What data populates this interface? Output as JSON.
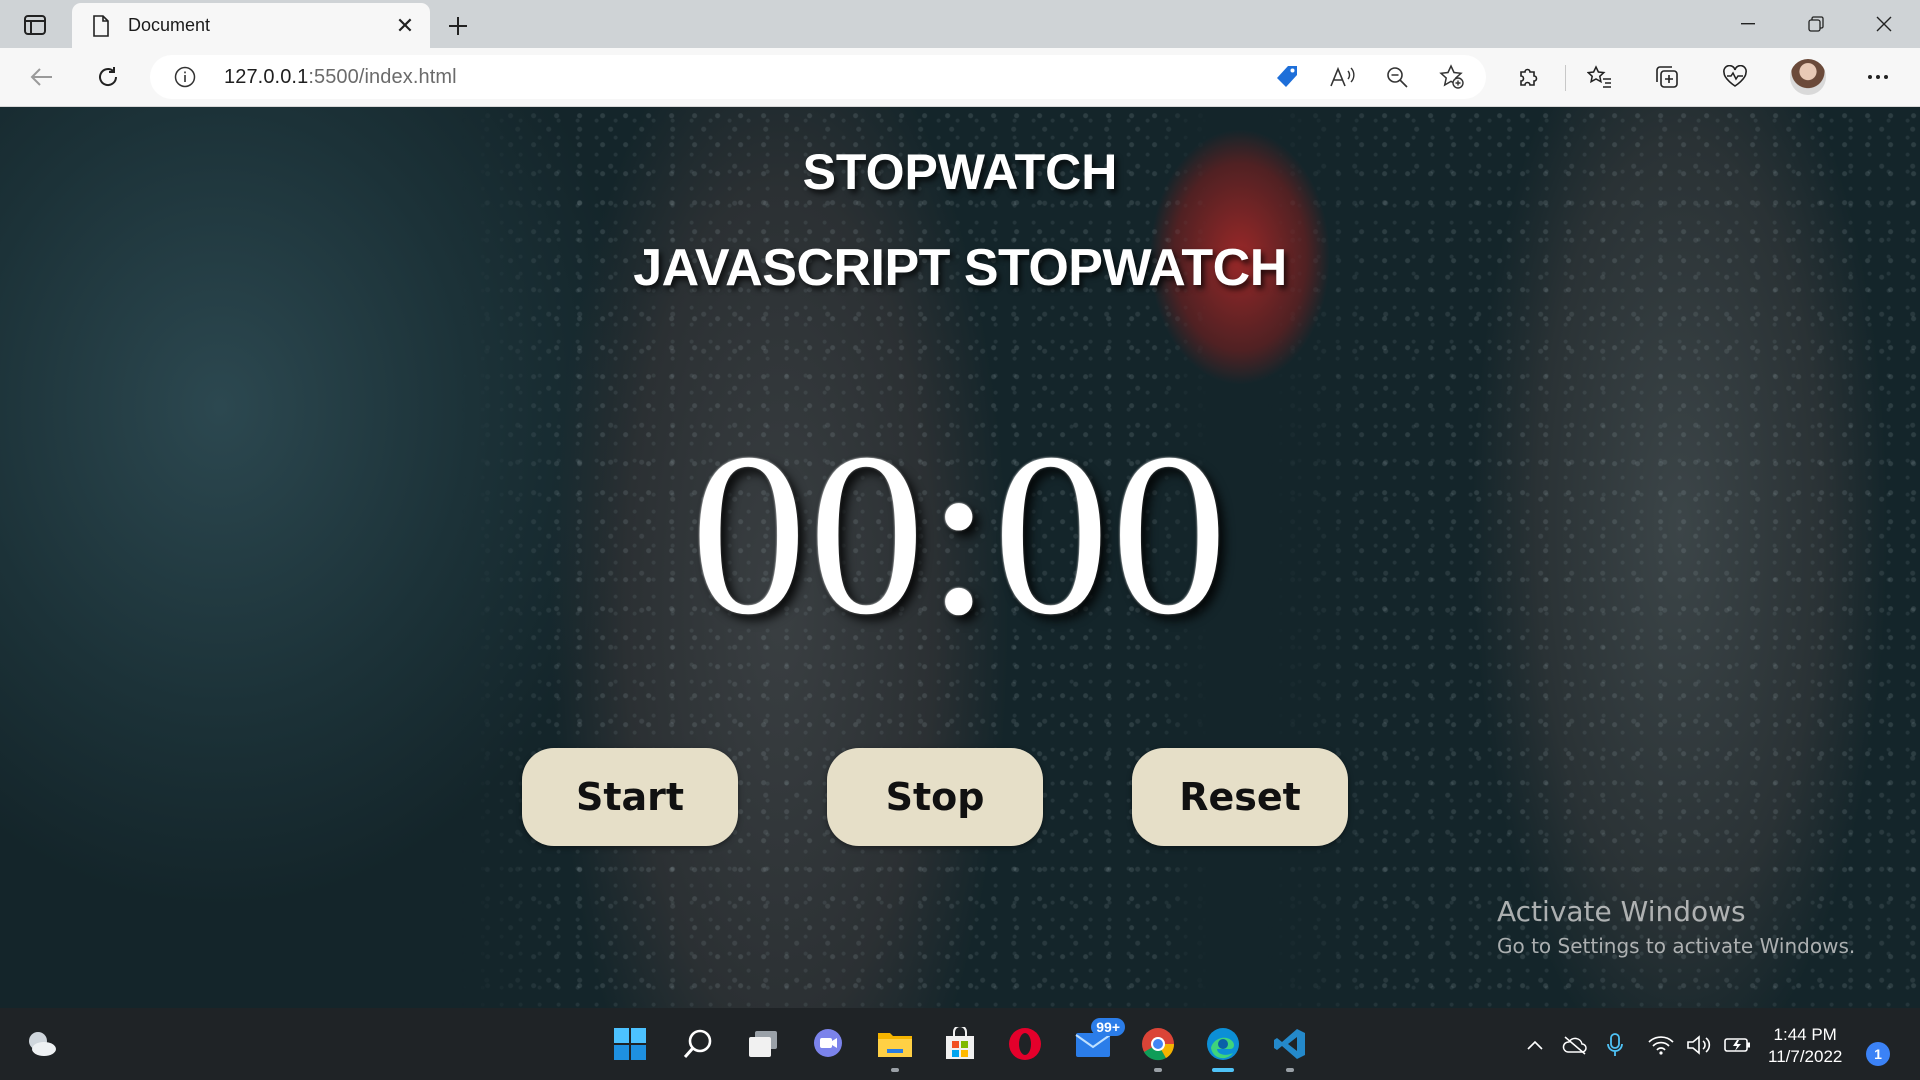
{
  "browser": {
    "tab_title": "Document",
    "url_host": "127.0.0.1",
    "url_path": ":5500/index.html"
  },
  "page": {
    "heading": "STOPWATCH",
    "subheading": "JAVASCRIPT STOPWATCH",
    "timer": "00:00",
    "buttons": {
      "start": "Start",
      "stop": "Stop",
      "reset": "Reset"
    }
  },
  "watermark": {
    "line1": "Activate Windows",
    "line2": "Go to Settings to activate Windows."
  },
  "taskbar": {
    "mail_badge": "99+",
    "time": "1:44 PM",
    "date": "11/7/2022",
    "notification_count": "1"
  },
  "colors": {
    "button_bg": "#e6dfc8",
    "edge_accent": "#4fc3f7"
  }
}
